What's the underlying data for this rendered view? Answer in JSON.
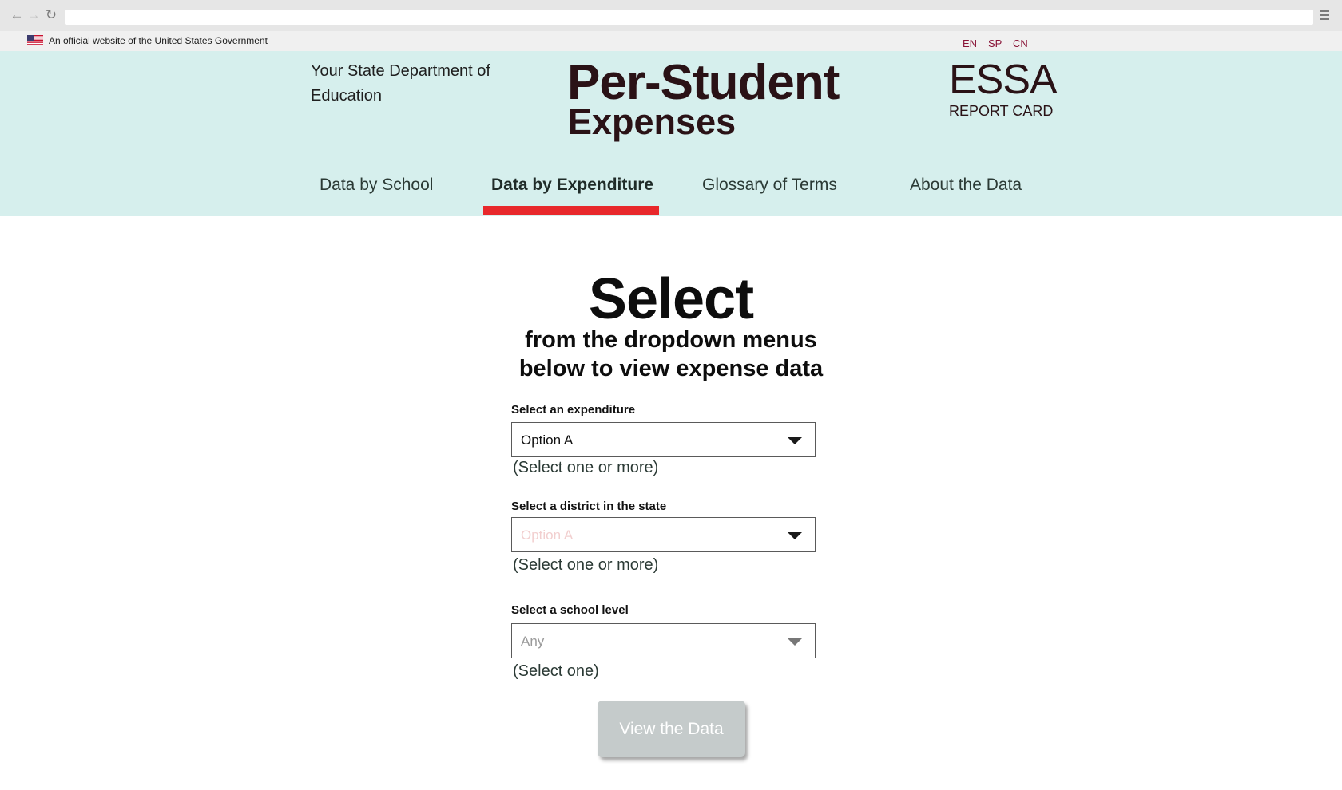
{
  "gov_banner": {
    "official_text": "An official website of the United States Government",
    "languages": [
      "EN",
      "SP",
      "CN"
    ]
  },
  "header": {
    "department": "Your State Department of Education",
    "title_line1": "Per-Student",
    "title_line2": "Expenses",
    "logo_main": "ESSA",
    "logo_sub": "REPORT CARD"
  },
  "nav": {
    "tabs": [
      {
        "label": "Data by School"
      },
      {
        "label": "Data by Expenditure",
        "active": true
      },
      {
        "label": "Glossary of Terms"
      },
      {
        "label": "About the Data"
      }
    ]
  },
  "main": {
    "heading": "Select",
    "subheading_line1": "from the dropdown menus",
    "subheading_line2": "below to view expense data",
    "fields": [
      {
        "label": "Select an expenditure",
        "value": "Option A",
        "hint": "(Select one or more)"
      },
      {
        "label": "Select a district in the state",
        "value": "Option A",
        "hint": "(Select one or more)"
      },
      {
        "label": "Select a school level",
        "value": "Any",
        "hint": "(Select one)"
      }
    ],
    "submit_label": "View the Data"
  },
  "colors": {
    "header_band": "#d6efed",
    "active_tab_underline": "#e8282b",
    "title_text": "#2a1216",
    "language_links": "#8a1538",
    "button_disabled": "#c5cbcb"
  },
  "icons": {
    "back": "arrow-left-icon",
    "forward": "arrow-right-icon",
    "reload": "reload-icon",
    "menu": "hamburger-menu-icon",
    "flag": "us-flag-icon",
    "dropdown": "caret-down-icon"
  }
}
